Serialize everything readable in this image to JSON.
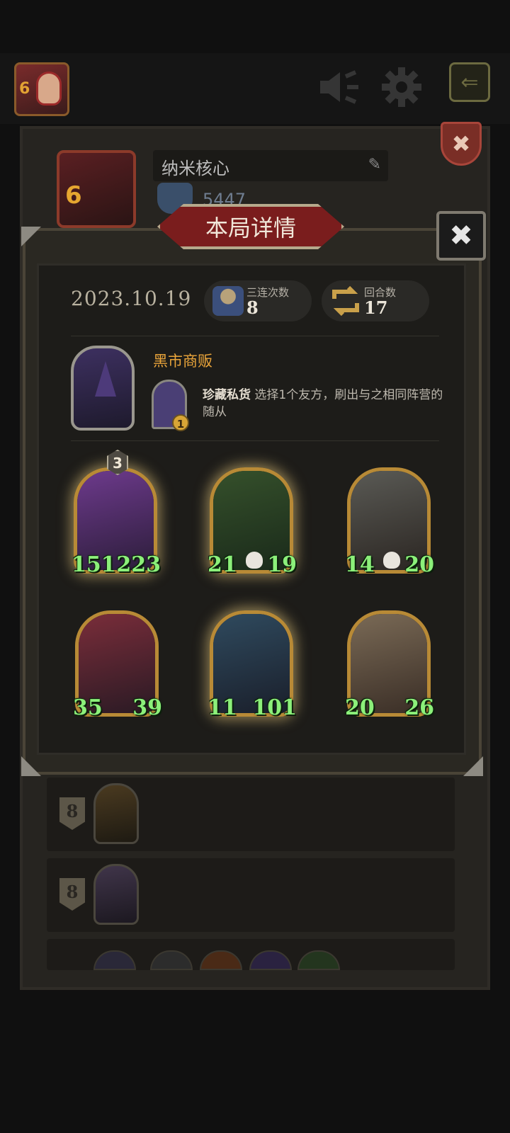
{
  "player": {
    "level": "6",
    "name": "纳米核心",
    "score": "5447"
  },
  "dialog": {
    "title": "本局详情",
    "date": "2023.10.19",
    "triples_label": "三连次数",
    "triples_value": "8",
    "rounds_label": "回合数",
    "rounds_value": "17"
  },
  "hero": {
    "name": "黑市商贩",
    "power_name": "珍藏私货",
    "power_desc": " 选择1个友方，刷出与之相同阵营的随从",
    "power_cost": "1"
  },
  "minions": [
    {
      "attack": "151",
      "health": "223",
      "tier": "3",
      "golden": true,
      "skull": false
    },
    {
      "attack": "21",
      "health": "19",
      "tier": "",
      "golden": true,
      "skull": true
    },
    {
      "attack": "14",
      "health": "20",
      "tier": "",
      "golden": false,
      "skull": true
    },
    {
      "attack": "35",
      "health": "39",
      "tier": "",
      "golden": false,
      "skull": false
    },
    {
      "attack": "11",
      "health": "101",
      "tier": "",
      "golden": true,
      "skull": false
    },
    {
      "attack": "20",
      "health": "26",
      "tier": "",
      "golden": false,
      "skull": false
    }
  ],
  "history_rows": [
    {
      "rank": "8"
    },
    {
      "rank": "8"
    }
  ],
  "icons": {
    "speaker": "speaker-icon",
    "settings": "gear-icon",
    "exit": "exit-icon",
    "close": "close-icon",
    "edit": "pencil-icon"
  },
  "colors": {
    "accent_gold": "#e9a43a",
    "stat_green": "#8cf07a",
    "banner_red": "#7a1d1d"
  }
}
